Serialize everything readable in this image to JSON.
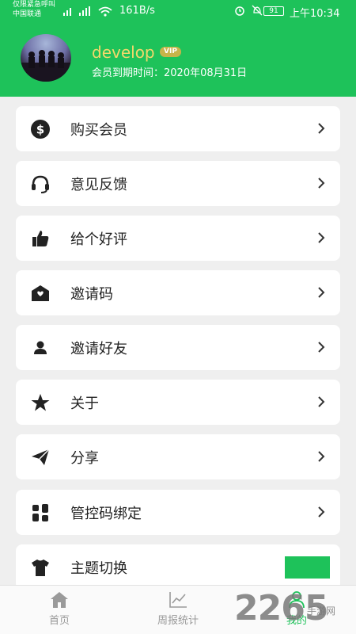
{
  "status_bar": {
    "carrier_line1": "仅限紧急呼叫",
    "carrier_line2": "中国联通",
    "speed": "161B/s",
    "battery": "91",
    "time": "上午10:34"
  },
  "profile": {
    "username": "develop",
    "badge": "VIP",
    "expire": "会员到期时间：2020年08月31日"
  },
  "menu": {
    "items": [
      {
        "label": "购买会员",
        "icon": "dollar-icon"
      },
      {
        "label": "意见反馈",
        "icon": "headset-icon"
      },
      {
        "label": "给个好评",
        "icon": "thumbs-up-icon"
      },
      {
        "label": "邀请码",
        "icon": "envelope-heart-icon"
      },
      {
        "label": "邀请好友",
        "icon": "person-icon"
      },
      {
        "label": "关于",
        "icon": "star-icon"
      },
      {
        "label": "分享",
        "icon": "paper-plane-icon"
      },
      {
        "label": "管控码绑定",
        "icon": "grid-icon"
      },
      {
        "label": "主题切换",
        "icon": "tshirt-icon",
        "swatch": "#1ec25a"
      }
    ]
  },
  "tabs": [
    {
      "label": "首页",
      "icon": "home-icon"
    },
    {
      "label": "周报统计",
      "icon": "chart-icon"
    },
    {
      "label": "我的",
      "icon": "user-icon",
      "active": true
    }
  ],
  "watermark": {
    "number": "2265",
    "text": "手游网"
  },
  "colors": {
    "primary": "#1ec25a",
    "username": "#f2d86b",
    "vip_badge": "#c8b44a"
  }
}
